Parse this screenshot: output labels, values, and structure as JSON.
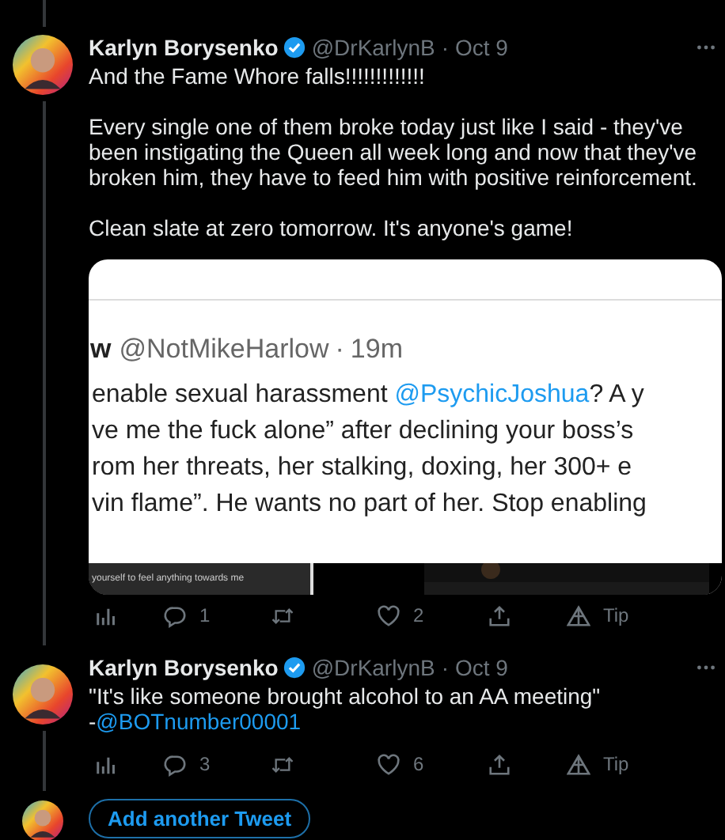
{
  "thread": [
    {
      "author": {
        "name": "Karlyn Borysenko",
        "verified": true,
        "handle": "@DrKarlynB",
        "separator": "·",
        "time": "Oct 9"
      },
      "paragraphs": [
        [
          {
            "kind": "text",
            "text": "And the Fame Whore falls!!!!!!!!!!!!!"
          }
        ],
        [
          {
            "kind": "text",
            "text": "Every single one of them broke today just like I said - they've been instigating the Queen all week long and now that they've broken him, they have to feed him with positive reinforcement."
          }
        ],
        [
          {
            "kind": "text",
            "text": "Clean slate at zero tomorrow. It's anyone's game!"
          }
        ]
      ],
      "embed": {
        "author_tail": "w",
        "handle": "@NotMikeHarlow",
        "separator": "·",
        "time": "19m",
        "lines": [
          [
            {
              "kind": "text",
              "text": "enable sexual harassment "
            },
            {
              "kind": "mention",
              "text": "@PsychicJoshua"
            },
            {
              "kind": "text",
              "text": "? A y"
            }
          ],
          [
            {
              "kind": "text",
              "text": "ve me the fuck alone” after declining your boss’s"
            }
          ],
          [
            {
              "kind": "text",
              "text": "rom her threats, her stalking, doxing, her 300+ e"
            }
          ],
          [
            {
              "kind": "text",
              "text": "vin flame”. He wants no part of her. Stop enabling"
            }
          ]
        ],
        "caption": "yourself to feel anything towards me"
      },
      "actions": [
        {
          "kind": "analytics"
        },
        {
          "kind": "reply",
          "count": "1"
        },
        {
          "kind": "retweet"
        },
        {
          "kind": "like",
          "count": "2"
        },
        {
          "kind": "share"
        },
        {
          "kind": "tip",
          "label": "Tip"
        }
      ]
    },
    {
      "author": {
        "name": "Karlyn Borysenko",
        "verified": true,
        "handle": "@DrKarlynB",
        "separator": "·",
        "time": "Oct 9"
      },
      "paragraphs": [
        [
          {
            "kind": "text",
            "text": "\"It's like someone brought alcohol to an AA meeting\""
          },
          {
            "kind": "break"
          },
          {
            "kind": "text",
            "text": "-"
          },
          {
            "kind": "mention",
            "text": "@BOTnumber00001"
          }
        ]
      ],
      "actions": [
        {
          "kind": "analytics"
        },
        {
          "kind": "reply",
          "count": "3"
        },
        {
          "kind": "retweet"
        },
        {
          "kind": "like",
          "count": "6"
        },
        {
          "kind": "share"
        },
        {
          "kind": "tip",
          "label": "Tip"
        }
      ]
    }
  ],
  "compose": {
    "button": "Add another Tweet"
  }
}
